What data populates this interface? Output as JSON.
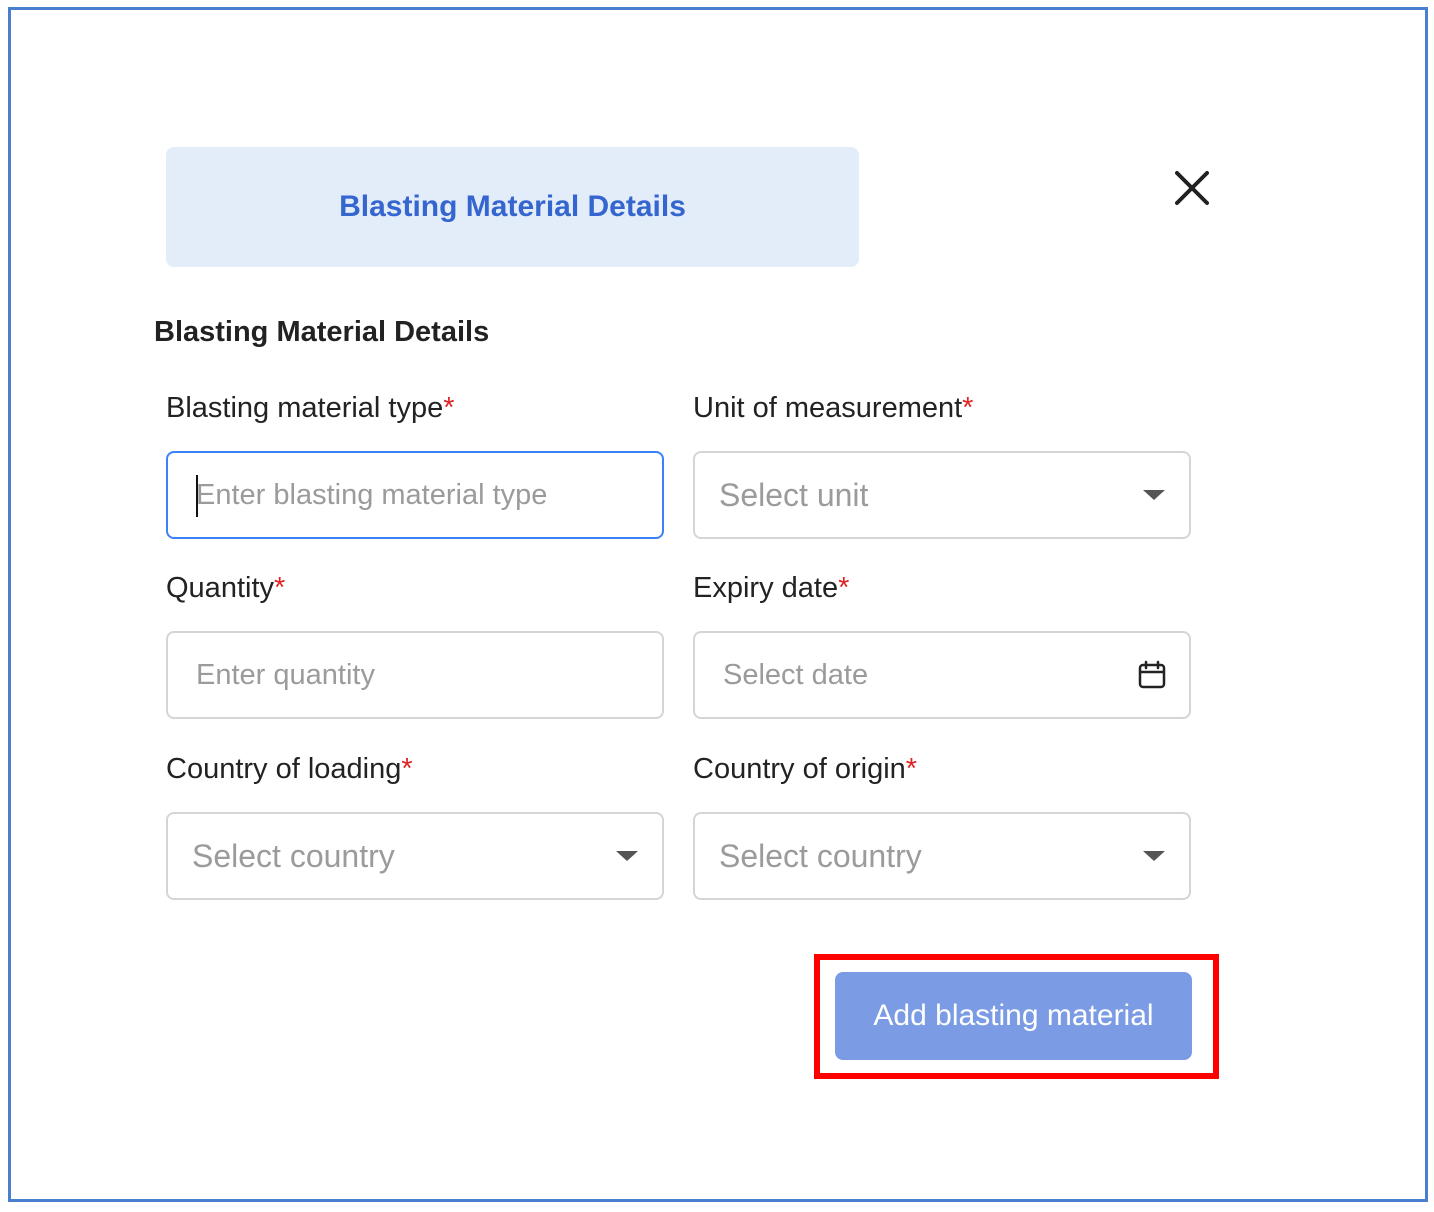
{
  "modal": {
    "tab_title": "Blasting Material Details",
    "section_title": "Blasting Material Details",
    "required_marker": "*"
  },
  "fields": {
    "material_type": {
      "label": "Blasting material type",
      "placeholder": "Enter blasting material type",
      "value": ""
    },
    "unit": {
      "label": "Unit of measurement",
      "placeholder": "Select unit"
    },
    "quantity": {
      "label": "Quantity",
      "placeholder": "Enter quantity",
      "value": ""
    },
    "expiry_date": {
      "label": "Expiry date",
      "placeholder": "Select date"
    },
    "country_loading": {
      "label": "Country of loading",
      "placeholder": "Select country"
    },
    "country_origin": {
      "label": "Country of origin",
      "placeholder": "Select country"
    }
  },
  "actions": {
    "add_label": "Add blasting material"
  },
  "icons": {
    "close": "close-icon",
    "dropdown": "caret-down-icon",
    "calendar": "calendar-icon"
  },
  "colors": {
    "accent": "#3565cf",
    "tab_background": "#e3edf9",
    "button": "#7b9be5",
    "required": "#e02424",
    "highlight": "#ff0000",
    "frame": "#4a7fcf"
  }
}
